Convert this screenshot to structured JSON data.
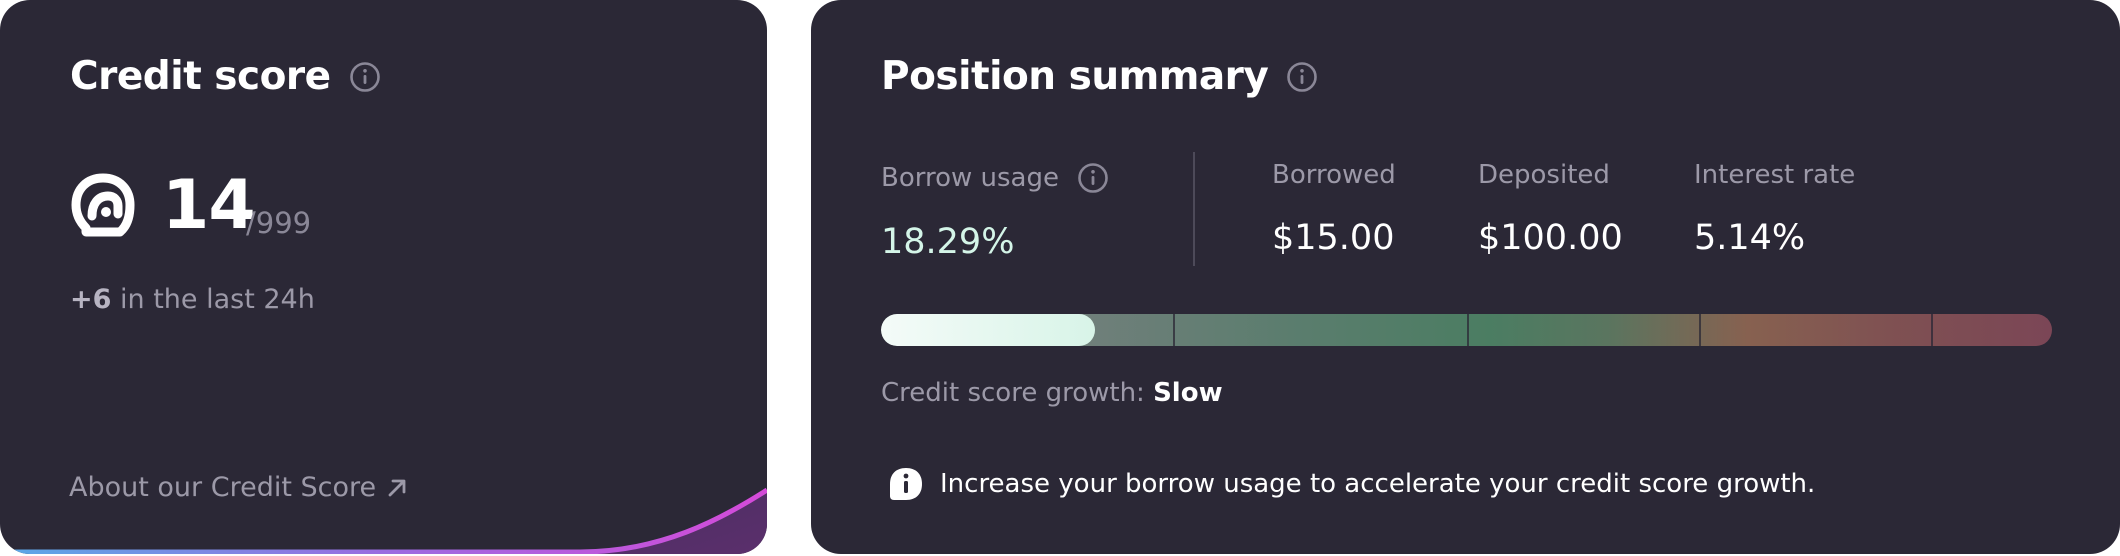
{
  "credit_score": {
    "title": "Credit score",
    "score": "14",
    "max": "/999",
    "delta": "+6",
    "delta_suffix": " in the last 24h",
    "about_link": "About our Credit Score"
  },
  "position_summary": {
    "title": "Position summary",
    "borrow_usage_label": "Borrow usage",
    "borrow_usage_value": "18.29%",
    "borrow_usage_fraction": 0.1829,
    "borrowed_label": "Borrowed",
    "borrowed_value": "$15.00",
    "deposited_label": "Deposited",
    "deposited_value": "$100.00",
    "interest_rate_label": "Interest rate",
    "interest_rate_value": "5.14%",
    "growth_label": "Credit score growth: ",
    "growth_value": "Slow",
    "tip": "Increase your borrow usage to accelerate your credit score growth."
  },
  "colors": {
    "card_bg": "#2b2836",
    "accent_glow": "#d54ad9",
    "usage_value": "#d4f5e8"
  }
}
